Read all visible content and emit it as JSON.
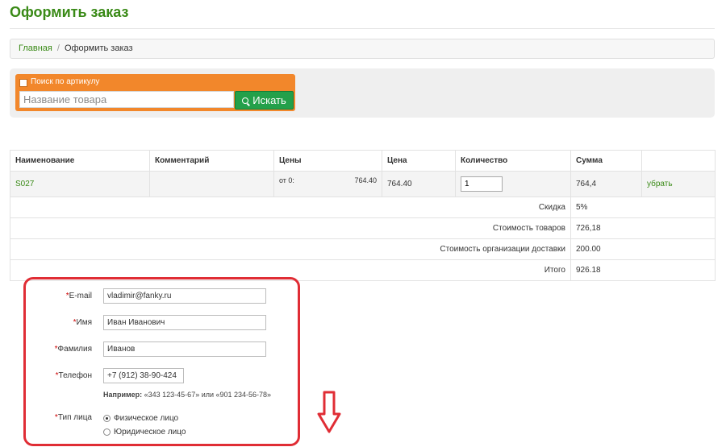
{
  "page": {
    "title": "Оформить заказ"
  },
  "breadcrumb": {
    "home": "Главная",
    "separator": "/",
    "current": "Оформить заказ"
  },
  "search": {
    "checkbox_label": "Поиск по артикулу",
    "placeholder": "Название товара",
    "button_label": "Искать"
  },
  "table": {
    "headers": [
      "Наименование",
      "Комментарий",
      "Цены",
      "Цена",
      "Количество",
      "Сумма",
      ""
    ],
    "rows": [
      {
        "name": "S027",
        "comment": "",
        "price_from": "от 0:",
        "price_tier": "764.40",
        "price": "764.40",
        "quantity": "1",
        "sum": "764,4",
        "remove": "убрать"
      }
    ],
    "summary": [
      {
        "label": "Скидка",
        "value": "5%"
      },
      {
        "label": "Стоимость товаров",
        "value": "726,18"
      },
      {
        "label": "Стоимость организации доставки",
        "value": "200.00"
      },
      {
        "label": "Итого",
        "value": "926.18"
      }
    ]
  },
  "form": {
    "required_mark": "*",
    "email": {
      "label": "E-mail",
      "value": "vladimir@fanky.ru"
    },
    "first_name": {
      "label": "Имя",
      "value": "Иван Иванович"
    },
    "last_name": {
      "label": "Фамилия",
      "value": "Иванов"
    },
    "phone": {
      "label": "Телефон",
      "value": "+7 (912) 38-90-424"
    },
    "phone_hint": {
      "prefix": "Например:",
      "text": " «343 123-45-67» или «901 234-56-78»"
    },
    "person_type": {
      "label": "Тип лица",
      "options": [
        "Физическое лицо",
        "Юридическое лицо"
      ],
      "selected": "Физическое лицо"
    }
  },
  "annotation": {
    "color": "#e02d35",
    "arrow_icon": "arrow-down-icon"
  }
}
